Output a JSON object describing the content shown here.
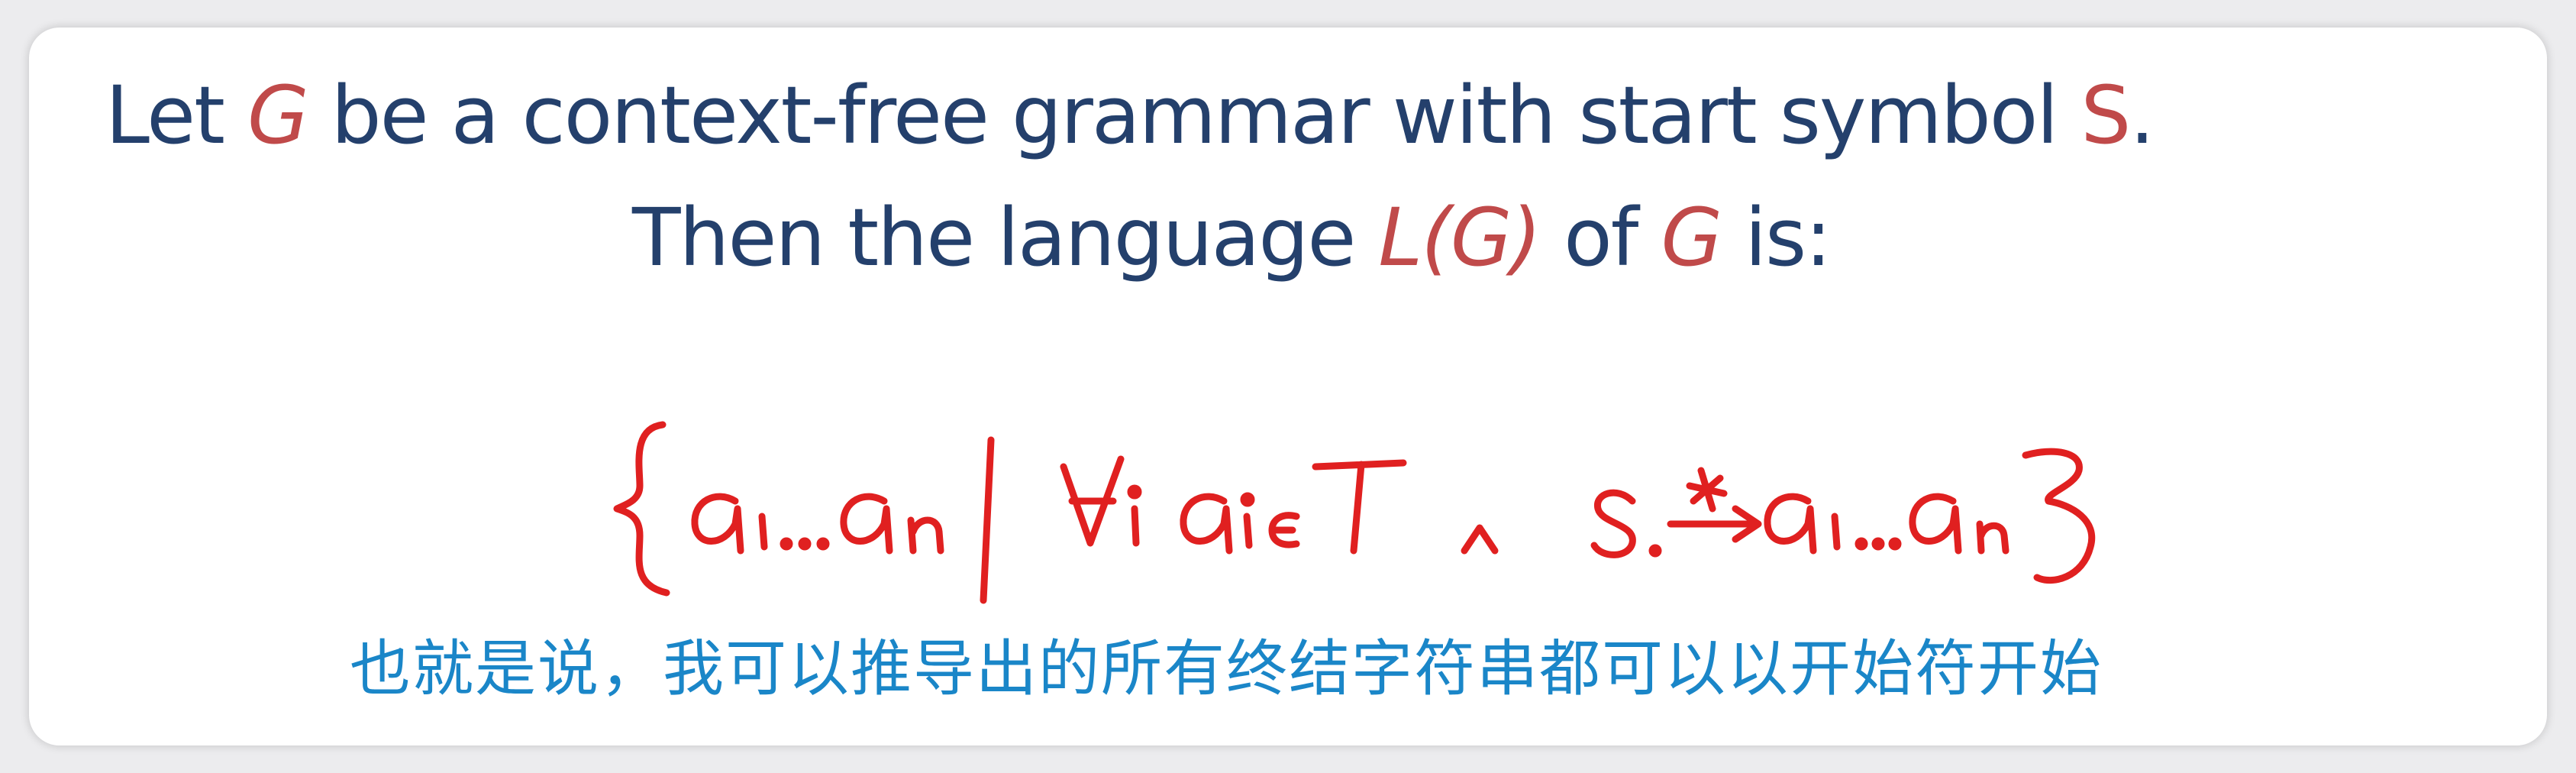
{
  "slide": {
    "line1": {
      "pre": "Let ",
      "g": "G",
      "mid": " be a context-free grammar with start symbol ",
      "s": "S",
      "end": "."
    },
    "line2": {
      "pre": "Then the language ",
      "lg": "L(G)",
      "mid": " of ",
      "g": "G",
      "end": " is:"
    }
  },
  "subtitle": "也就是说，我可以推导出的所有终结字符串都可以以开始符开始",
  "colors": {
    "text": "#24406c",
    "accent": "#c04a4a",
    "ink": "#e02020",
    "subtitle": "#1a86c8"
  }
}
